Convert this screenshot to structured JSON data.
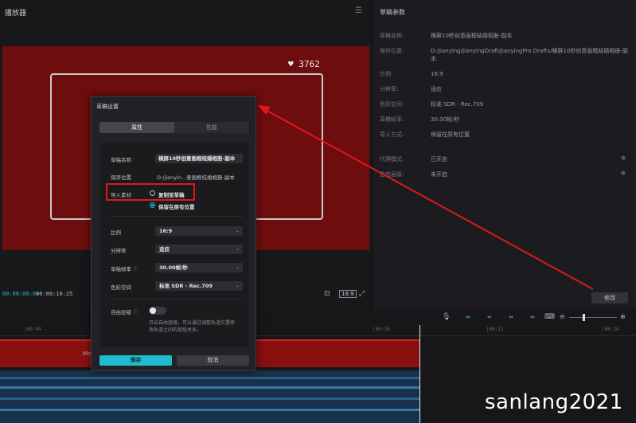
{
  "player": {
    "title": "播放器",
    "likes": "3762",
    "timecode_current": "00:00:00:00",
    "timecode_total": "00:00:10:25",
    "ratio_badge": "16:9"
  },
  "props": {
    "title": "草稿参数",
    "rows": [
      {
        "label": "草稿名称:",
        "value": "横屏10秒创意画框结婚相册-副本"
      },
      {
        "label": "保存位置:",
        "value": "D:/jianying/JianyingDraft/JianyingPro Drafts/横屏10秒创意画框结婚相册-副本"
      },
      {
        "label": "比例:",
        "value": "16:9"
      },
      {
        "label": "分辨率:",
        "value": "适应"
      },
      {
        "label": "色彩空间:",
        "value": "标准 SDR - Rec.709"
      },
      {
        "label": "草稿帧率:",
        "value": "30.00帧/秒"
      },
      {
        "label": "导入方式:",
        "value": "保留在原有位置"
      },
      {
        "label": "代理模式:",
        "value": "已开启"
      },
      {
        "label": "自由层级:",
        "value": "未开启"
      }
    ],
    "modify_label": "修改"
  },
  "timeline": {
    "ticks": [
      "|00:04",
      "|00:10",
      "|00:12",
      "|00:14"
    ],
    "track_label": "Mo"
  },
  "dialog": {
    "title": "草稿设置",
    "tabs": [
      "属性",
      "性能"
    ],
    "name_label": "草稿名称",
    "name_value": "横屏10秒创意画框结婚相册-副本",
    "location_label": "保存位置",
    "location_value": "D:/jianyin...意画框结婚相册-副本",
    "import_label": "导入素材",
    "import_options": [
      "复制至草稿",
      "保留在原有位置"
    ],
    "ratio_label": "比例",
    "ratio_value": "16:9",
    "resolution_label": "分辨率",
    "resolution_value": "适应",
    "fps_label": "草稿帧率",
    "fps_value": "30.00帧/秒",
    "color_label": "色彩空间",
    "color_value": "标准 SDR - Rec.709",
    "free_label": "自由层级",
    "free_desc": "开启自由层级，可以通过调整轨道位置修改轨道之间的层级关系。",
    "save_label": "保存",
    "cancel_label": "取消"
  },
  "watermark": "sanlang2021",
  "colors": {
    "accent": "#1fbcd0",
    "highlight": "#e01818",
    "video_bg": "#6e0d0d"
  }
}
